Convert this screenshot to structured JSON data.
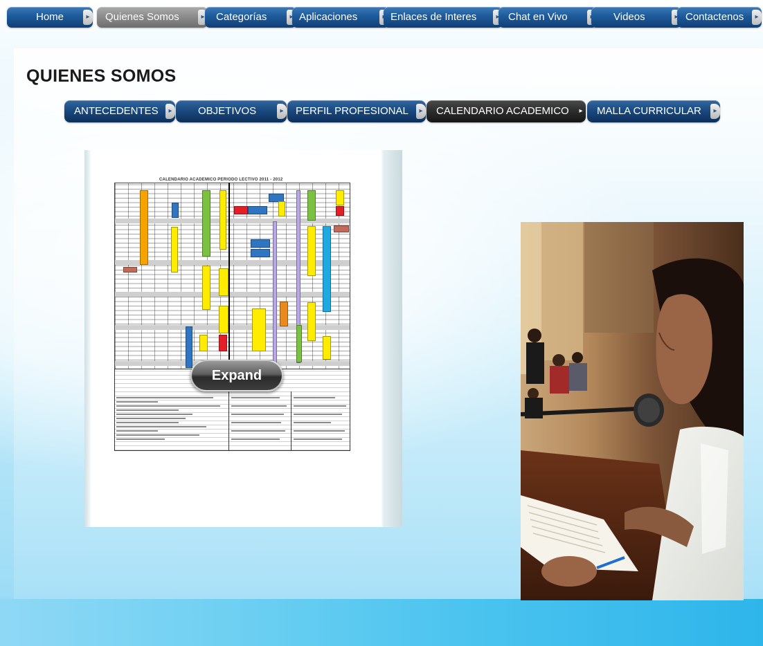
{
  "top_nav": [
    {
      "label": "Home",
      "active": false
    },
    {
      "label": "Quienes Somos",
      "active": true
    },
    {
      "label": "Categorías",
      "active": false
    },
    {
      "label": "Aplicaciones",
      "active": false
    },
    {
      "label": "Enlaces de Interes",
      "active": false
    },
    {
      "label": "Chat en Vivo",
      "active": false
    },
    {
      "label": "Videos",
      "active": false
    },
    {
      "label": "Contactenos",
      "active": false
    }
  ],
  "page_title": "QUIENES SOMOS",
  "sub_nav": [
    {
      "label": "ANTECEDENTES",
      "active": false
    },
    {
      "label": "OBJETIVOS",
      "active": false
    },
    {
      "label": "PERFIL PROFESIONAL",
      "active": false
    },
    {
      "label": "CALENDARIO ACADEMICO",
      "active": true
    },
    {
      "label": "MALLA CURRICULAR",
      "active": false
    }
  ],
  "document": {
    "title": "CALENDARIO ACADEMICO PERIODO LECTIVO 2011 - 2012",
    "expand_label": "Expand"
  },
  "colors": {
    "nav_blue": "#1d5a9a",
    "nav_active_gray": "#8a8a8a",
    "subnav_active": "#2c2c2c",
    "cal_orange": "#f5a300",
    "cal_yellow": "#ffec00",
    "cal_green": "#7cc242",
    "cal_blue": "#2f75c2",
    "cal_cyan": "#1fa9e1",
    "cal_red": "#e21e26",
    "cal_purple": "#9e8fd6"
  }
}
